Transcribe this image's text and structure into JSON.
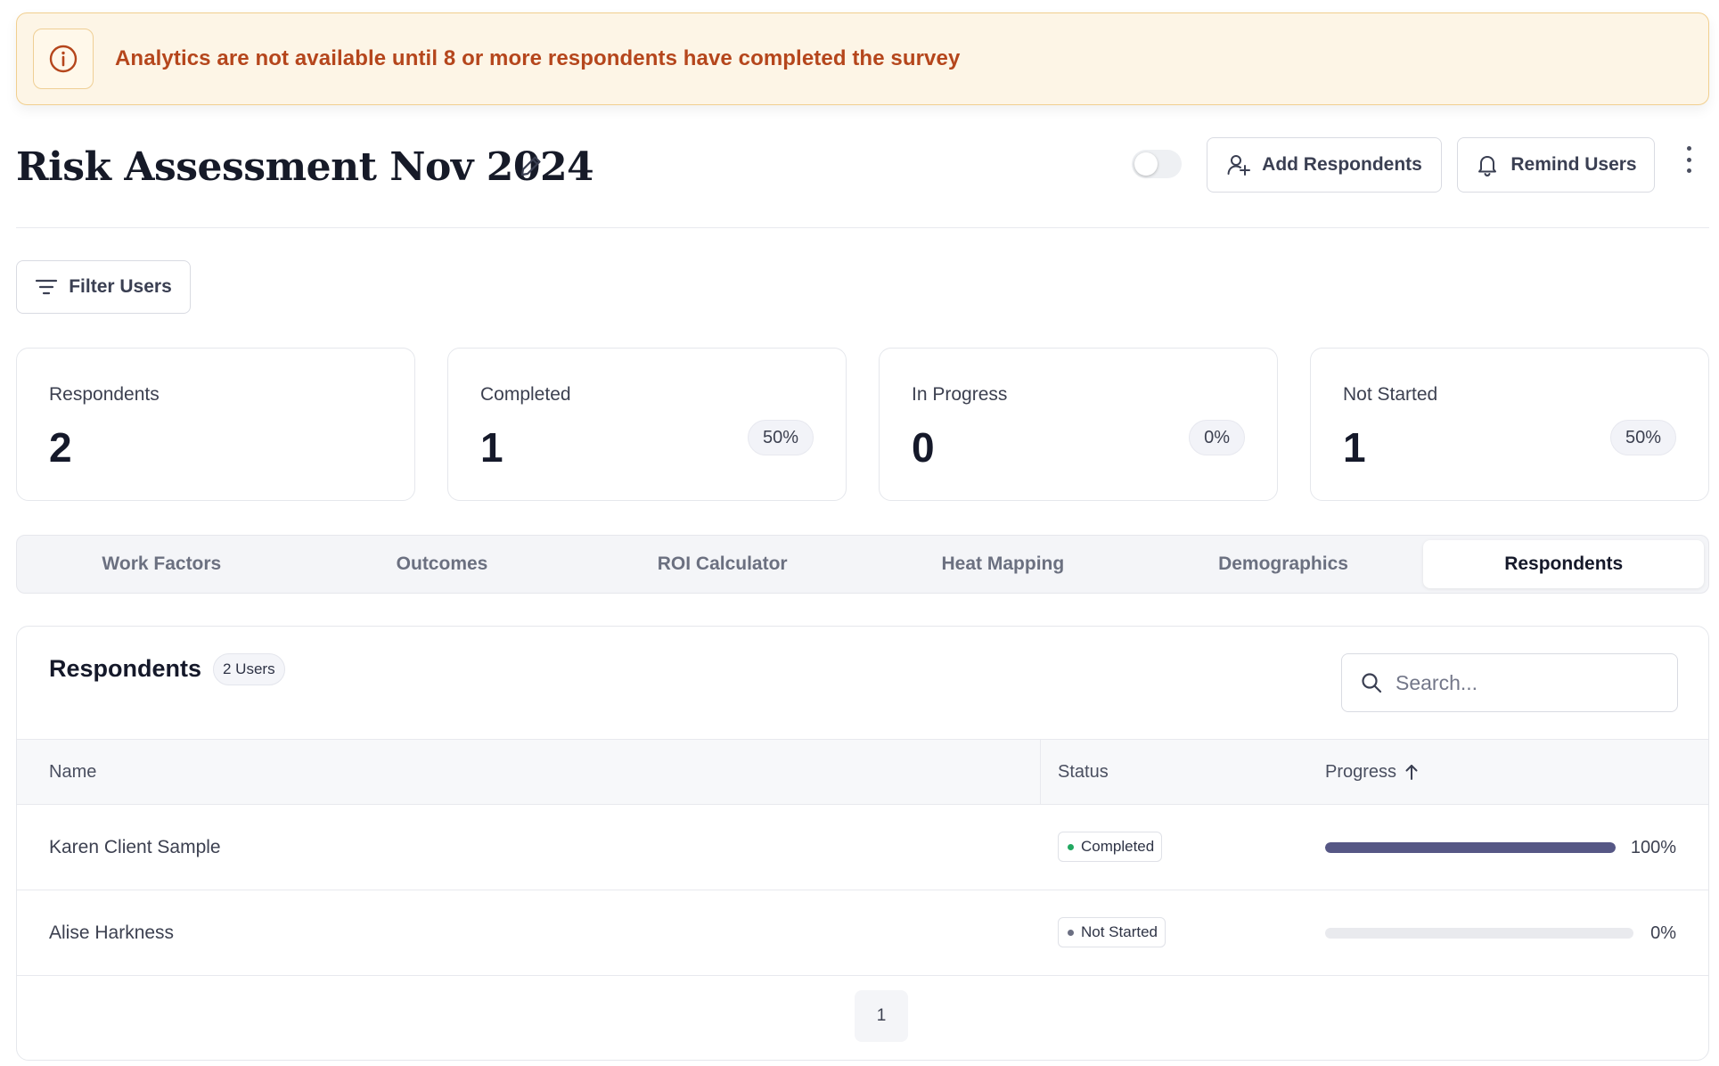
{
  "alert": {
    "message": "Analytics are not available until 8 or more respondents have completed the survey",
    "icon": "info-circle-icon"
  },
  "header": {
    "title": "Risk Assessment Nov 2024",
    "add_respondents_label": "Add Respondents",
    "remind_users_label": "Remind Users",
    "toggle_on": false
  },
  "filter": {
    "label": "Filter Users"
  },
  "stats": [
    {
      "label": "Respondents",
      "value": "2",
      "pct": ""
    },
    {
      "label": "Completed",
      "value": "1",
      "pct": "50%"
    },
    {
      "label": "In Progress",
      "value": "0",
      "pct": "0%"
    },
    {
      "label": "Not Started",
      "value": "1",
      "pct": "50%"
    }
  ],
  "tabs": [
    {
      "label": "Work Factors",
      "active": false
    },
    {
      "label": "Outcomes",
      "active": false
    },
    {
      "label": "ROI Calculator",
      "active": false
    },
    {
      "label": "Heat Mapping",
      "active": false
    },
    {
      "label": "Demographics",
      "active": false
    },
    {
      "label": "Respondents",
      "active": true
    }
  ],
  "respondents": {
    "title": "Respondents",
    "count_badge": "2 Users",
    "search_placeholder": "Search...",
    "columns": {
      "name": "Name",
      "status": "Status",
      "progress": "Progress"
    },
    "rows": [
      {
        "name": "Karen Client Sample",
        "status": "Completed",
        "status_color": "#22a861",
        "progress": 100,
        "progress_label": "100%"
      },
      {
        "name": "Alise Harkness",
        "status": "Not Started",
        "status_color": "#6b6f82",
        "progress": 0,
        "progress_label": "0%"
      }
    ],
    "page": "1"
  },
  "colors": {
    "alert_text": "#b5461c",
    "alert_bg": "#fdf5e6",
    "progress_fill": "#565785"
  }
}
